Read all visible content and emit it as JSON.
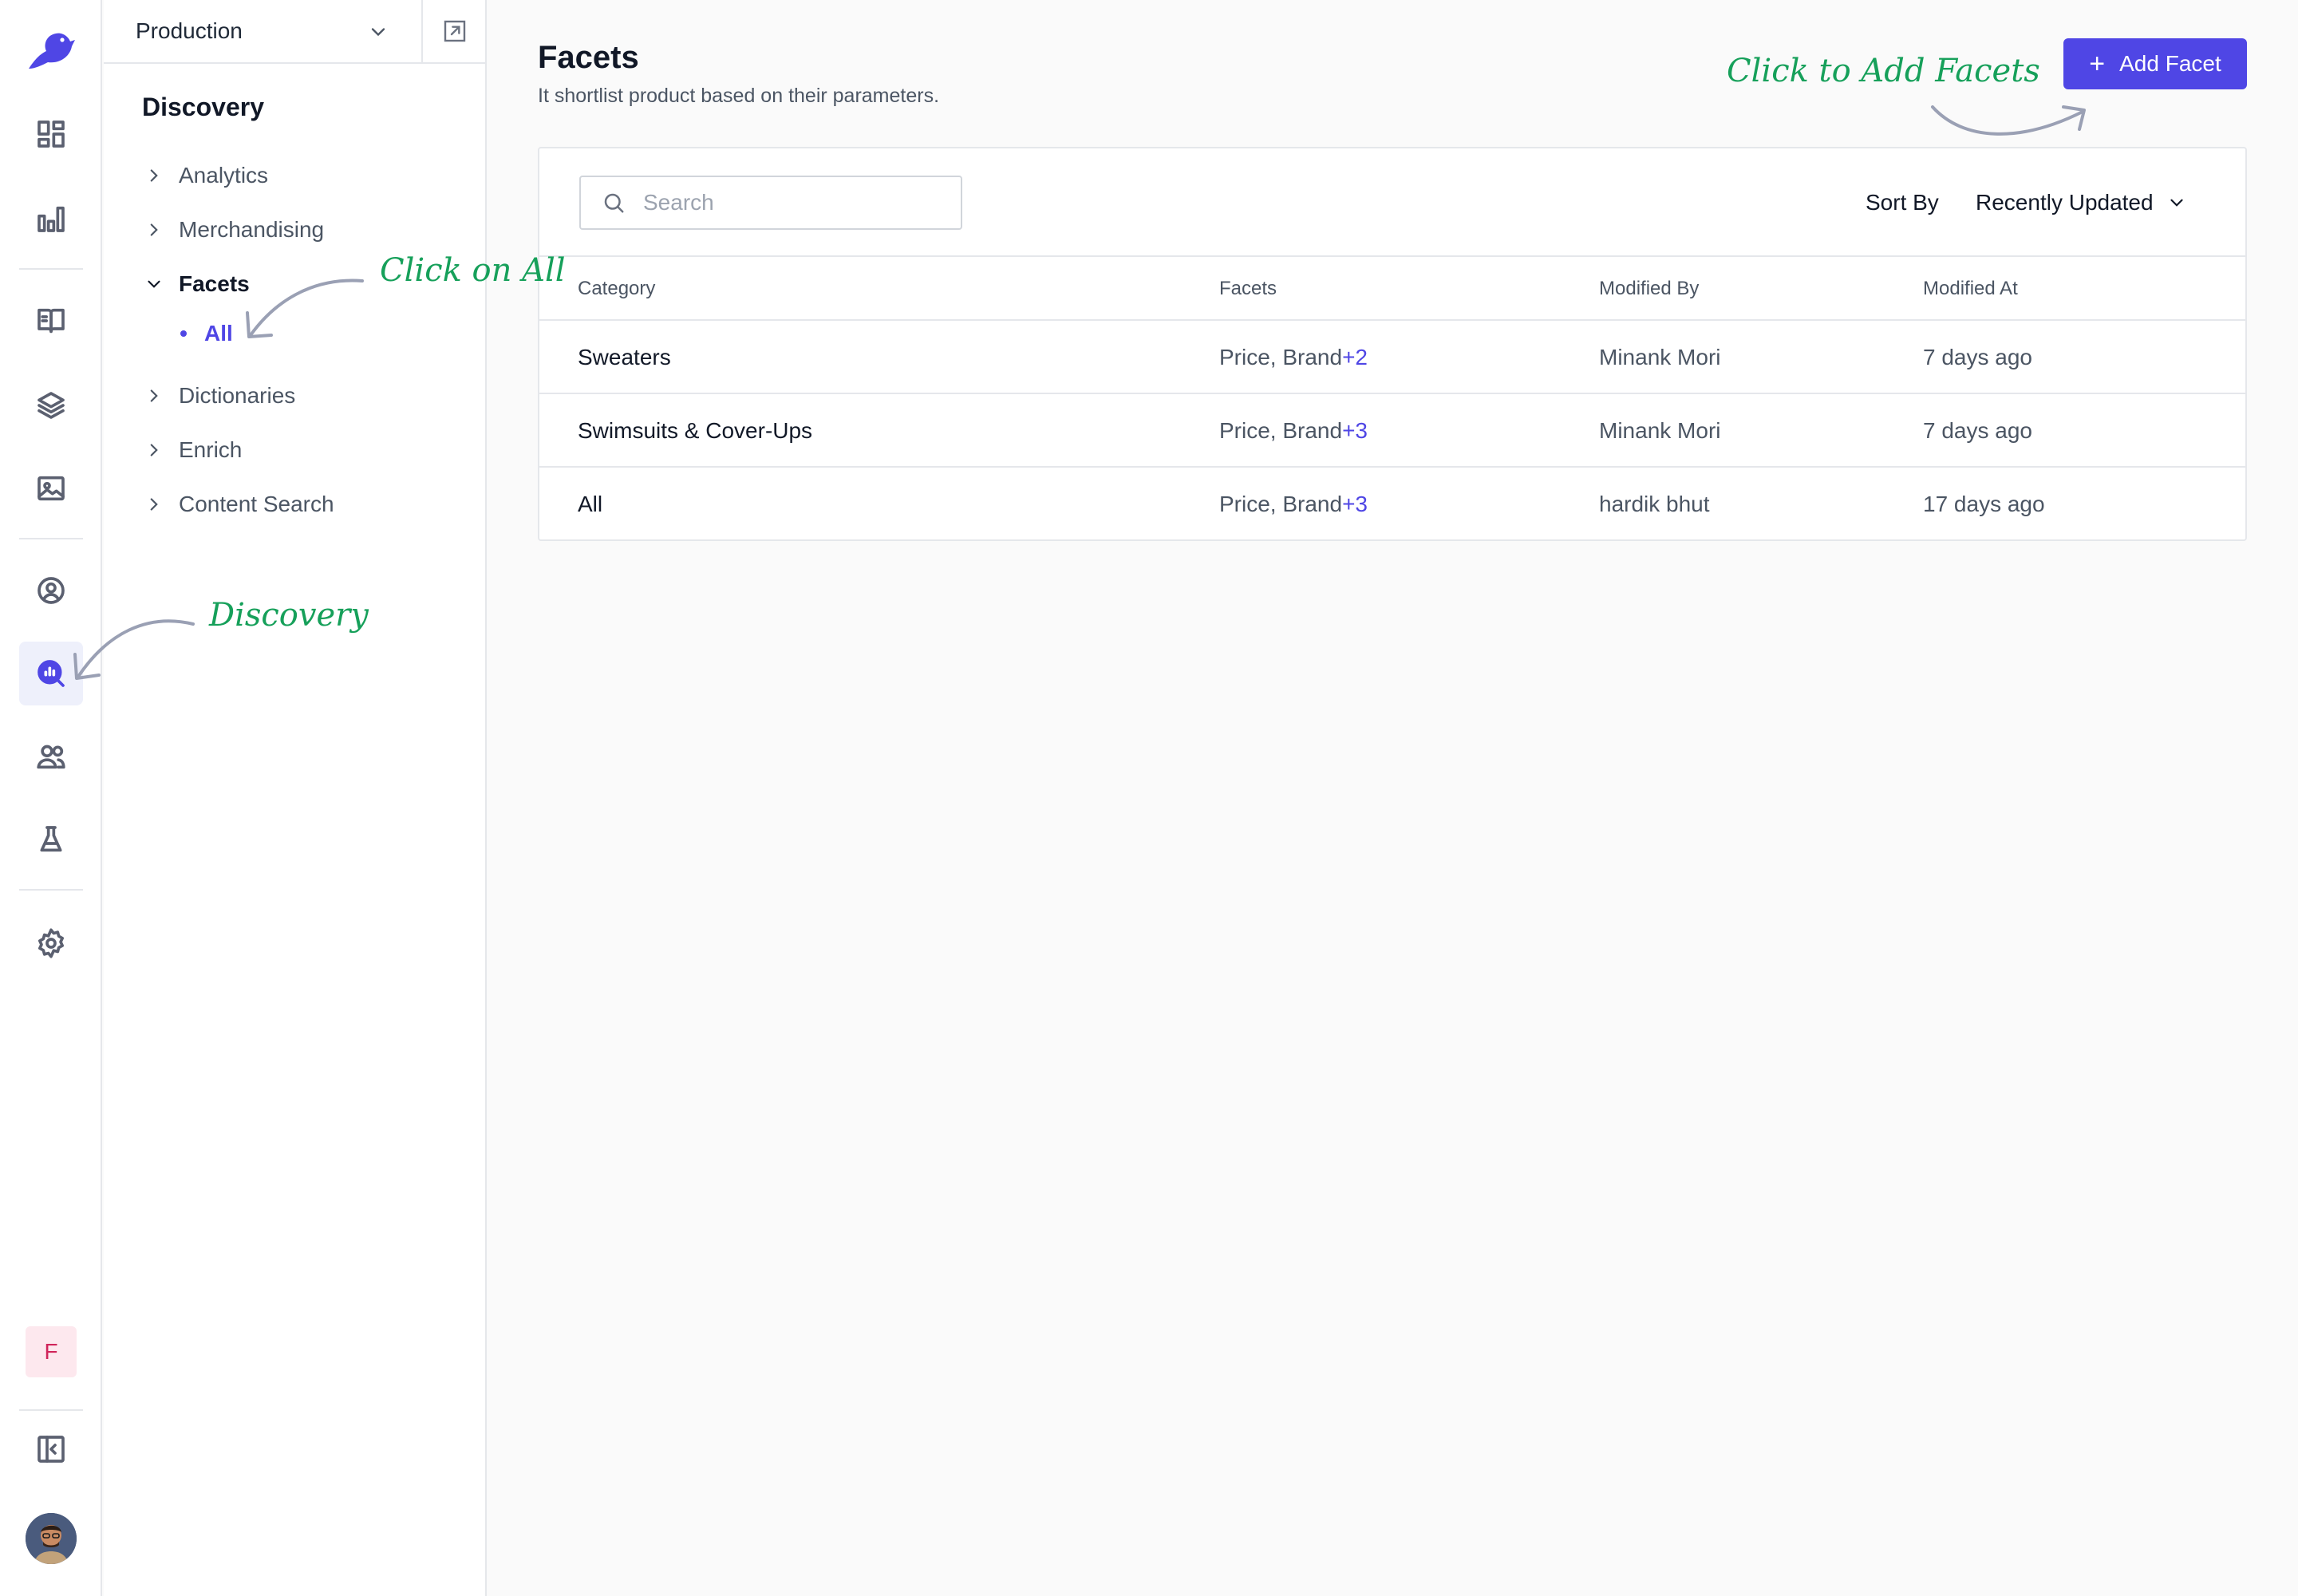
{
  "rail": {
    "items": [
      {
        "icon": "dashboard-icon"
      },
      {
        "icon": "analytics-icon"
      },
      {
        "icon": "catalog-book-icon"
      },
      {
        "icon": "layers-icon"
      },
      {
        "icon": "image-icon"
      },
      {
        "icon": "user-circle-icon"
      },
      {
        "icon": "discovery-search-icon"
      },
      {
        "icon": "users-icon"
      },
      {
        "icon": "experiments-flask-icon"
      },
      {
        "icon": "settings-gear-icon"
      },
      {
        "icon": "collapse-panel-icon"
      }
    ],
    "workspace_initial": "F"
  },
  "nav": {
    "environment": "Production",
    "title": "Discovery",
    "items": [
      {
        "label": "Analytics"
      },
      {
        "label": "Merchandising"
      },
      {
        "label": "Facets"
      },
      {
        "label": "Dictionaries"
      },
      {
        "label": "Enrich"
      },
      {
        "label": "Content Search"
      }
    ],
    "facets_sub": "All"
  },
  "main": {
    "title": "Facets",
    "subtitle": "It shortlist product based on their parameters.",
    "add_button": "Add Facet",
    "search_placeholder": "Search",
    "sort_label": "Sort By",
    "sort_value": "Recently Updated",
    "columns": [
      "Category",
      "Facets",
      "Modified By",
      "Modified At"
    ],
    "rows": [
      {
        "category": "Sweaters",
        "facets": "Price, Brand",
        "more": "+2",
        "modified_by": "Minank Mori",
        "modified_at": "7 days ago"
      },
      {
        "category": "Swimsuits & Cover-Ups",
        "facets": "Price, Brand",
        "more": "+3",
        "modified_by": "Minank Mori",
        "modified_at": "7 days ago"
      },
      {
        "category": "All",
        "facets": "Price, Brand",
        "more": "+3",
        "modified_by": "hardik bhut",
        "modified_at": "17 days ago"
      }
    ]
  },
  "annotations": {
    "add_facets": "Click to Add Facets",
    "click_all": "Click on All",
    "discovery": "Discovery"
  },
  "colors": {
    "accent": "#4f46e5",
    "annotation": "#16a05a",
    "workspace_bg": "#fde8ee",
    "workspace_fg": "#d0245a"
  }
}
